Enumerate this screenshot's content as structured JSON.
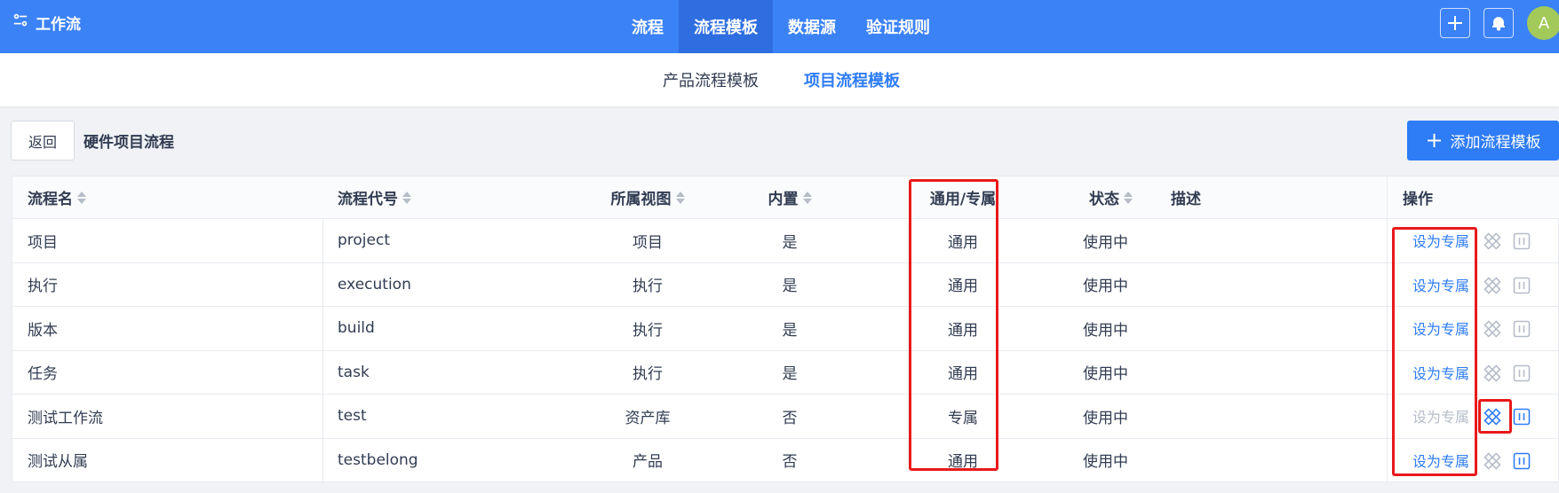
{
  "header": {
    "brand": "工作流",
    "nav": [
      {
        "label": "流程",
        "active": false
      },
      {
        "label": "流程模板",
        "active": true
      },
      {
        "label": "数据源",
        "active": false
      },
      {
        "label": "验证规则",
        "active": false
      }
    ],
    "avatar": "A"
  },
  "subnav": {
    "tabs": [
      {
        "label": "产品流程模板",
        "active": false
      },
      {
        "label": "项目流程模板",
        "active": true
      }
    ]
  },
  "toolbar": {
    "back_label": "返回",
    "title": "硬件项目流程",
    "add_label": "添加流程模板"
  },
  "table": {
    "columns": [
      "流程名",
      "流程代号",
      "所属视图",
      "内置",
      "通用/专属",
      "状态",
      "描述",
      "操作"
    ],
    "rows": [
      {
        "name": "项目",
        "code": "project",
        "view": "项目",
        "builtin": "是",
        "scope": "通用",
        "status": "使用中",
        "desc": "",
        "action": "设为专属",
        "action_enabled": true,
        "design_enabled": false,
        "pause_enabled": false
      },
      {
        "name": "执行",
        "code": "execution",
        "view": "执行",
        "builtin": "是",
        "scope": "通用",
        "status": "使用中",
        "desc": "",
        "action": "设为专属",
        "action_enabled": true,
        "design_enabled": false,
        "pause_enabled": false
      },
      {
        "name": "版本",
        "code": "build",
        "view": "执行",
        "builtin": "是",
        "scope": "通用",
        "status": "使用中",
        "desc": "",
        "action": "设为专属",
        "action_enabled": true,
        "design_enabled": false,
        "pause_enabled": false
      },
      {
        "name": "任务",
        "code": "task",
        "view": "执行",
        "builtin": "是",
        "scope": "通用",
        "status": "使用中",
        "desc": "",
        "action": "设为专属",
        "action_enabled": true,
        "design_enabled": false,
        "pause_enabled": false
      },
      {
        "name": "测试工作流",
        "code": "test",
        "view": "资产库",
        "builtin": "否",
        "scope": "专属",
        "status": "使用中",
        "desc": "",
        "action": "设为专属",
        "action_enabled": false,
        "design_enabled": true,
        "pause_enabled": true
      },
      {
        "name": "测试从属",
        "code": "testbelong",
        "view": "产品",
        "builtin": "否",
        "scope": "通用",
        "status": "使用中",
        "desc": "",
        "action": "设为专属",
        "action_enabled": true,
        "design_enabled": false,
        "pause_enabled": true
      }
    ]
  },
  "colors": {
    "primary": "#2e7cf6",
    "header_bg": "#3b82f6",
    "highlight": "#e8191a",
    "muted": "#b6bcc8"
  }
}
